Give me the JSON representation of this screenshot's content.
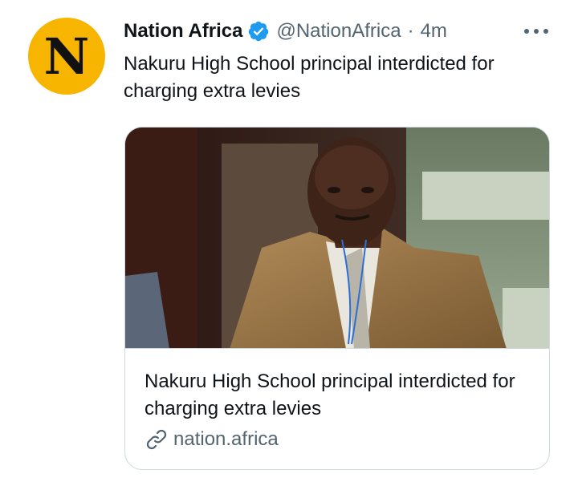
{
  "tweet": {
    "author": {
      "avatar_letter": "N",
      "display_name": "Nation Africa",
      "handle": "@NationAfrica",
      "separator": "·",
      "time": "4m",
      "avatar_color": "#f7b500",
      "verified_color": "#1d9bf0"
    },
    "more_icon": "more-horizontal-icon",
    "text": "Nakuru High School principal interdicted for charging extra levies",
    "card": {
      "image_icon": "news-photo",
      "title": "Nakuru High School principal interdicted for charging extra levies",
      "domain": "nation.africa",
      "link_icon": "link-icon"
    }
  },
  "colors": {
    "text_primary": "#0f1419",
    "text_secondary": "#536471",
    "border": "#cfd9de"
  }
}
